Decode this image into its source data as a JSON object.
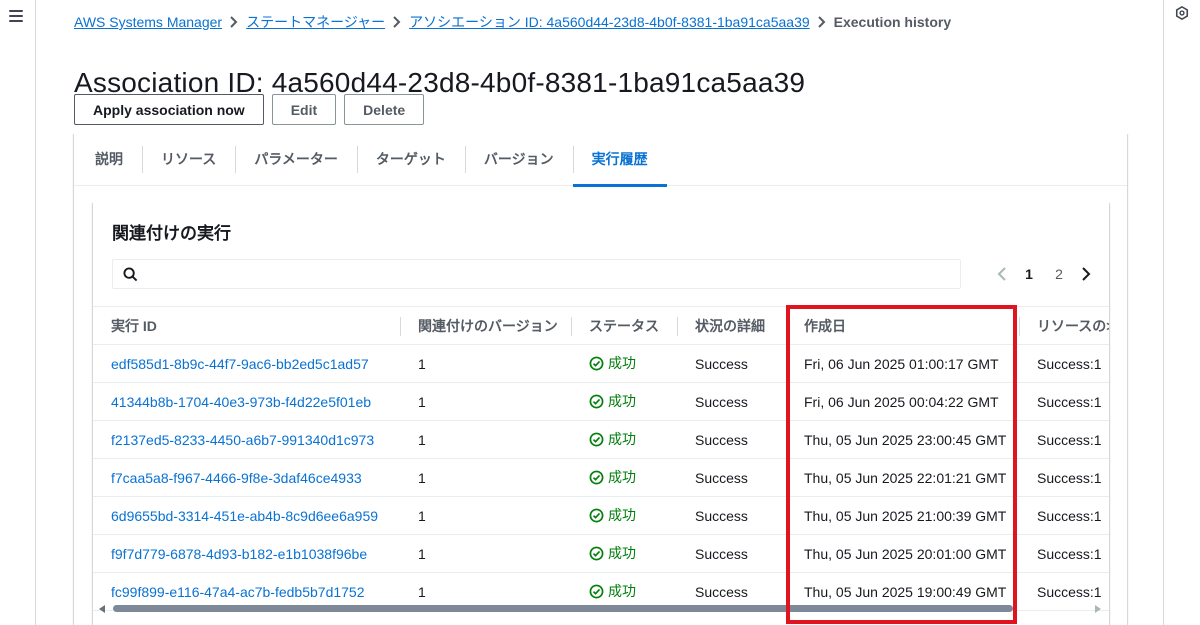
{
  "breadcrumb": {
    "items": [
      "AWS Systems Manager",
      "ステートマネージャー",
      "アソシエーション ID: 4a560d44-23d8-4b0f-8381-1ba91ca5aa39"
    ],
    "current": "Execution history"
  },
  "header": {
    "title": "Association ID: 4a560d44-23d8-4b0f-8381-1ba91ca5aa39"
  },
  "actions": {
    "apply_label": "Apply association now",
    "edit_label": "Edit",
    "delete_label": "Delete"
  },
  "tabs": [
    {
      "label": "説明"
    },
    {
      "label": "リソース"
    },
    {
      "label": "パラメーター"
    },
    {
      "label": "ターゲット"
    },
    {
      "label": "バージョン"
    },
    {
      "label": "実行履歴",
      "active": true
    }
  ],
  "executions": {
    "title": "関連付けの実行",
    "search": {
      "placeholder": ""
    },
    "pagination": {
      "current": "1",
      "next": "2"
    },
    "columns": [
      "実行 ID",
      "関連付けのバージョン",
      "ステータス",
      "状況の詳細",
      "作成日",
      "リソースの>"
    ],
    "rows": [
      {
        "id": "edf585d1-8b9c-44f7-9ac6-bb2ed5c1ad57",
        "version": "1",
        "status": "成功",
        "detail": "Success",
        "created": "Fri, 06 Jun 2025 01:00:17 GMT",
        "resources": "Success:1"
      },
      {
        "id": "41344b8b-1704-40e3-973b-f4d22e5f01eb",
        "version": "1",
        "status": "成功",
        "detail": "Success",
        "created": "Fri, 06 Jun 2025 00:04:22 GMT",
        "resources": "Success:1"
      },
      {
        "id": "f2137ed5-8233-4450-a6b7-991340d1c973",
        "version": "1",
        "status": "成功",
        "detail": "Success",
        "created": "Thu, 05 Jun 2025 23:00:45 GMT",
        "resources": "Success:1"
      },
      {
        "id": "f7caa5a8-f967-4466-9f8e-3daf46ce4933",
        "version": "1",
        "status": "成功",
        "detail": "Success",
        "created": "Thu, 05 Jun 2025 22:01:21 GMT",
        "resources": "Success:1"
      },
      {
        "id": "6d9655bd-3314-451e-ab4b-8c9d6ee6a959",
        "version": "1",
        "status": "成功",
        "detail": "Success",
        "created": "Thu, 05 Jun 2025 21:00:39 GMT",
        "resources": "Success:1"
      },
      {
        "id": "f9f7d779-6878-4d93-b182-e1b1038f96be",
        "version": "1",
        "status": "成功",
        "detail": "Success",
        "created": "Thu, 05 Jun 2025 20:01:00 GMT",
        "resources": "Success:1"
      },
      {
        "id": "fc99f899-e116-47a4-ac7b-fedb5b7d1752",
        "version": "1",
        "status": "成功",
        "detail": "Success",
        "created": "Thu, 05 Jun 2025 19:00:49 GMT",
        "resources": "Success:1"
      }
    ]
  },
  "colors": {
    "link": "#0972d3",
    "success": "#037f0c",
    "highlight_box": "#e0141e"
  },
  "icons": [
    "menu-icon",
    "chevron-right-icon",
    "search-icon",
    "chevron-left-icon",
    "success-check-icon",
    "info-icon"
  ]
}
